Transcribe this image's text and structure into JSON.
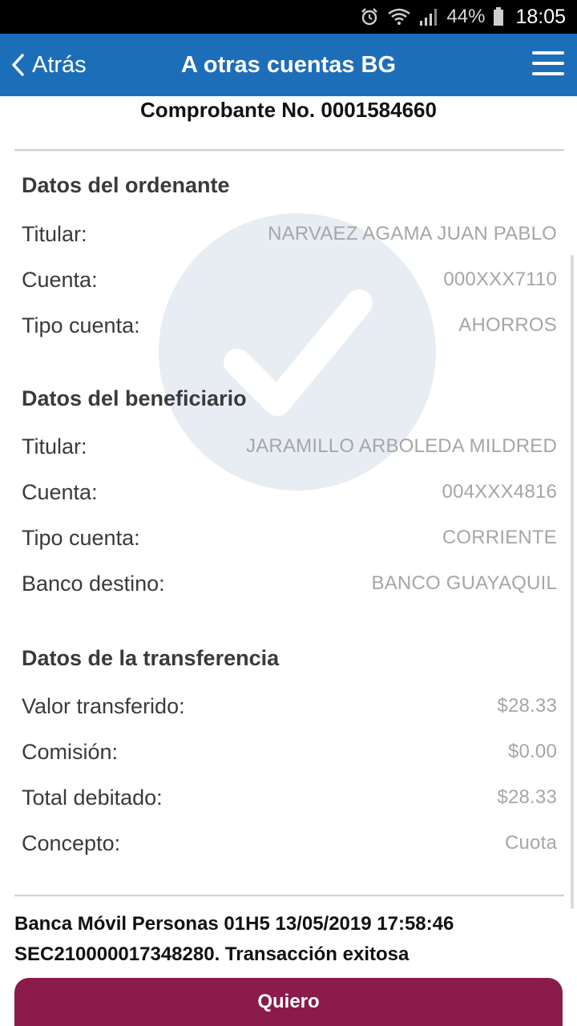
{
  "status_bar": {
    "battery_pct": "44%",
    "time": "18:05",
    "icons": [
      "alarm-icon",
      "wifi-icon",
      "signal-icon",
      "battery-icon"
    ]
  },
  "appbar": {
    "back_label": "Atrás",
    "title": "A otras cuentas BG",
    "color": "#1d6eb9"
  },
  "receipt": {
    "number_label": "Comprobante No. 0001584660"
  },
  "ordenante": {
    "title": "Datos del ordenante",
    "rows": [
      {
        "label": "Titular:",
        "value": "NARVAEZ AGAMA JUAN PABLO"
      },
      {
        "label": "Cuenta:",
        "value": "000XXX7110"
      },
      {
        "label": "Tipo cuenta:",
        "value": "AHORROS"
      }
    ]
  },
  "beneficiario": {
    "title": "Datos del beneficiario",
    "rows": [
      {
        "label": "Titular:",
        "value": "JARAMILLO ARBOLEDA MILDRED"
      },
      {
        "label": "Cuenta:",
        "value": "004XXX4816"
      },
      {
        "label": "Tipo cuenta:",
        "value": "CORRIENTE"
      },
      {
        "label": "Banco destino:",
        "value": "BANCO GUAYAQUIL"
      }
    ]
  },
  "transferencia": {
    "title": "Datos de la transferencia",
    "rows": [
      {
        "label": "Valor transferido:",
        "value": "$28.33"
      },
      {
        "label": "Comisión:",
        "value": "$0.00"
      },
      {
        "label": "Total debitado:",
        "value": "$28.33"
      },
      {
        "label": "Concepto:",
        "value": "Cuota"
      }
    ]
  },
  "footer": {
    "line1": "Banca Móvil Personas 01H5 13/05/2019 17:58:46",
    "line2": "SEC210000017348280. Transacción exitosa"
  },
  "cta": {
    "label": "Quiero",
    "color": "#8a1b4a"
  }
}
